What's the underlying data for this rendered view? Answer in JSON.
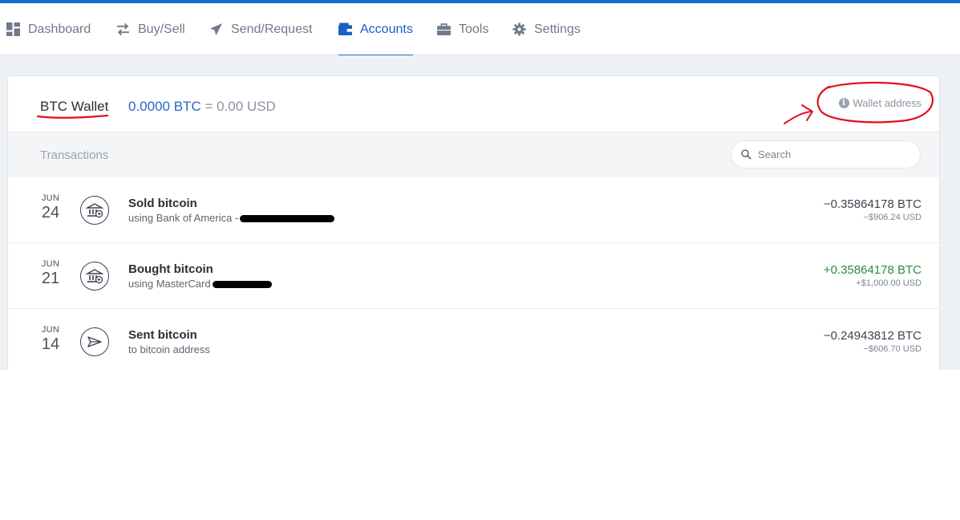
{
  "nav": {
    "items": [
      {
        "label": "Dashboard",
        "icon": "grid-icon"
      },
      {
        "label": "Buy/Sell",
        "icon": "swap-arrows-icon"
      },
      {
        "label": "Send/Request",
        "icon": "paper-plane-icon"
      },
      {
        "label": "Accounts",
        "icon": "wallet-icon",
        "active": true
      },
      {
        "label": "Tools",
        "icon": "briefcase-icon"
      },
      {
        "label": "Settings",
        "icon": "gear-icon"
      }
    ]
  },
  "wallet": {
    "name": "BTC Wallet",
    "balance_btc": "0.0000 BTC",
    "balance_usd": " = 0.00 USD",
    "address_label": "Wallet address"
  },
  "transactions": {
    "title": "Transactions",
    "search_placeholder": "Search",
    "rows": [
      {
        "month": "JUN",
        "day": "24",
        "title": "Sold bitcoin",
        "subtitle": "using Bank of America -",
        "amount": "−0.35864178 BTC",
        "usd": "−$906.24 USD",
        "icon": "bank-icon"
      },
      {
        "month": "JUN",
        "day": "21",
        "title": "Bought bitcoin",
        "subtitle": "using MasterCard",
        "amount": "+0.35864178 BTC",
        "usd": "+$1,000.00 USD",
        "icon": "bank-icon"
      },
      {
        "month": "JUN",
        "day": "14",
        "title": "Sent bitcoin",
        "subtitle": "to bitcoin address",
        "amount": "−0.24943812 BTC",
        "usd": "−$606.70 USD",
        "icon": "paper-plane-icon"
      }
    ]
  },
  "colors": {
    "accent": "#1a6ad1",
    "positive": "#2e8b3a",
    "annotation": "#e0101a"
  }
}
